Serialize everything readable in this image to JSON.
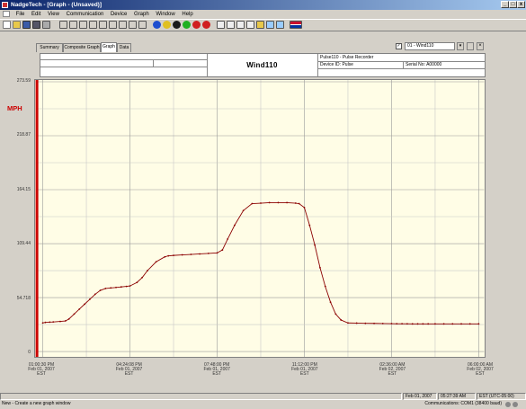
{
  "window": {
    "title": "NadgeTech - [Graph - (Unsaved)]",
    "min_label": "_",
    "max_label": "□",
    "close_label": "x"
  },
  "menu": [
    "File",
    "Edit",
    "View",
    "Communication",
    "Device",
    "Graph",
    "Window",
    "Help"
  ],
  "tabs": [
    "Summary",
    "Composite Graph",
    "Graph",
    "Data"
  ],
  "active_tab": "Graph",
  "channel_select": {
    "value": "01 - Wind110"
  },
  "header": {
    "device_title": "Pulse110 - Pulse Recorder",
    "device_id": "Device ID: Pulse",
    "serial": "Serial No: A00000",
    "name": "Wind110"
  },
  "chart_data": {
    "type": "line",
    "ylabel": "MPH",
    "ylim": [
      0,
      273.59
    ],
    "y_ticks": [
      "273.59",
      "218.87",
      "164.15",
      "109.44",
      "54.718",
      "0"
    ],
    "x_ticks": [
      [
        "01:00:30 PM",
        "Feb 01, 2007",
        "EST"
      ],
      [
        "04:24:08 PM",
        "Feb 01, 2007",
        "EST"
      ],
      [
        "07:48:00 PM",
        "Feb 01, 2007",
        "EST"
      ],
      [
        "11:12:00 PM",
        "Feb 01, 2007",
        "EST"
      ],
      [
        "02:36:00 AM",
        "Feb 02, 2007",
        "EST"
      ],
      [
        "06:00:00 AM",
        "Feb 02, 2007",
        "EST"
      ]
    ],
    "series": [
      {
        "name": "",
        "color": "#8b0000",
        "x": [
          0,
          0.03,
          0.08,
          0.12,
          0.2,
          0.26,
          0.3,
          0.36,
          0.42,
          0.48,
          0.54,
          0.6,
          0.66,
          0.72,
          0.78,
          0.84,
          0.9,
          0.96,
          1.0,
          1.08,
          1.14,
          1.2,
          1.3,
          1.4,
          1.44,
          1.5,
          1.6,
          1.7,
          1.8,
          1.9,
          2.0,
          2.06,
          2.12,
          2.2,
          2.3,
          2.4,
          2.5,
          2.6,
          2.7,
          2.8,
          2.9,
          2.94,
          3.0,
          3.06,
          3.12,
          3.18,
          3.24,
          3.3,
          3.36,
          3.42,
          3.5,
          3.6,
          3.7,
          3.8,
          3.9,
          4.0,
          4.06,
          4.12,
          4.18,
          4.24,
          4.3,
          4.36,
          4.42,
          4.5,
          4.6,
          4.7,
          4.8,
          4.9,
          5.0
        ],
        "y": [
          29,
          29.5,
          29.8,
          30,
          30.5,
          31,
          33,
          38,
          43,
          48,
          53,
          58,
          62,
          64,
          64.5,
          65,
          65.5,
          66,
          66.5,
          70,
          75,
          82,
          91,
          96,
          97,
          97.5,
          98,
          98.5,
          99,
          99.5,
          100,
          103,
          114,
          128,
          143,
          150,
          150.5,
          151,
          151,
          151,
          150.5,
          150,
          146,
          128,
          108,
          85,
          66,
          50,
          38,
          32,
          29,
          28.8,
          28.6,
          28.5,
          28.4,
          28.3,
          28.2,
          28.2,
          28.1,
          28,
          28,
          28,
          28,
          28,
          28,
          28,
          28,
          28,
          28
        ]
      }
    ]
  },
  "status": {
    "message": "New - Create a new graph window",
    "date": "Feb 01, 2007",
    "time": "05:27:39 AM",
    "tz": "EST (UTC-05:00)",
    "comm": "Communications: COM1 (38400 baud)"
  },
  "colors": {
    "accent": "#cc0000",
    "titlebar": "#0a246a",
    "plot_bg": "#fffde6",
    "line": "#8b0000"
  }
}
